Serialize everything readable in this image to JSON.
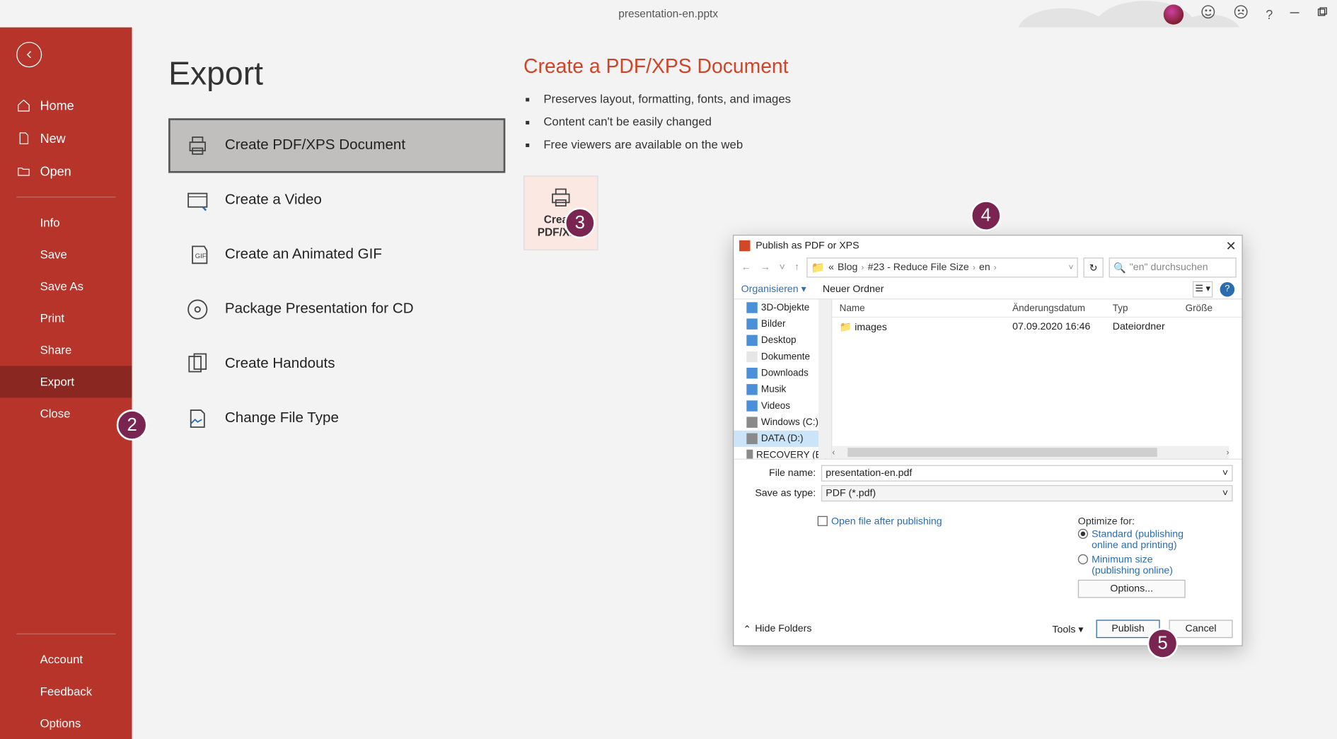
{
  "titlebar": {
    "filename": "presentation-en.pptx"
  },
  "sidebar": {
    "home": "Home",
    "new": "New",
    "open": "Open",
    "info": "Info",
    "save": "Save",
    "saveas": "Save As",
    "print": "Print",
    "share": "Share",
    "export": "Export",
    "close": "Close",
    "account": "Account",
    "feedback": "Feedback",
    "options": "Options"
  },
  "page": {
    "title": "Export"
  },
  "exportOptions": {
    "pdf": "Create PDF/XPS Document",
    "video": "Create a Video",
    "gif": "Create an Animated GIF",
    "cd": "Package Presentation for CD",
    "handouts": "Create Handouts",
    "filetype": "Change File Type"
  },
  "detail": {
    "heading": "Create a PDF/XPS Document",
    "b1": "Preserves layout, formatting, fonts, and images",
    "b2": "Content can't be easily changed",
    "b3": "Free viewers are available on the web",
    "btn1": "Create",
    "btn2": "PDF/XPS"
  },
  "dialog": {
    "title": "Publish as PDF or XPS",
    "crumbs": {
      "lead": "«",
      "c1": "Blog",
      "c2": "#23 - Reduce File Size",
      "c3": "en"
    },
    "searchPlaceholder": "\"en\" durchsuchen",
    "organise": "Organisieren ▾",
    "newfolder": "Neuer Ordner",
    "tree": {
      "t0": "3D-Objekte",
      "t1": "Bilder",
      "t2": "Desktop",
      "t3": "Dokumente",
      "t4": "Downloads",
      "t5": "Musik",
      "t6": "Videos",
      "t7": "Windows (C:)",
      "t8": "DATA (D:)",
      "t9": "RECOVERY (E:)"
    },
    "headers": {
      "name": "Name",
      "date": "Änderungsdatum",
      "type": "Typ",
      "size": "Größe"
    },
    "row": {
      "name": "images",
      "date": "07.09.2020 16:46",
      "type": "Dateiordner"
    },
    "labels": {
      "filename": "File name:",
      "savetype": "Save as type:"
    },
    "values": {
      "filename": "presentation-en.pdf",
      "savetype": "PDF (*.pdf)"
    },
    "openafter": "Open file after publishing",
    "optimize": "Optimize for:",
    "radio1": "Standard (publishing online and printing)",
    "radio2": "Minimum size (publishing online)",
    "optionsbtn": "Options...",
    "hidefolders": "Hide Folders",
    "tools": "Tools ▾",
    "publish": "Publish",
    "cancel": "Cancel"
  },
  "badges": {
    "b2": "2",
    "b3": "3",
    "b4": "4",
    "b5": "5"
  }
}
